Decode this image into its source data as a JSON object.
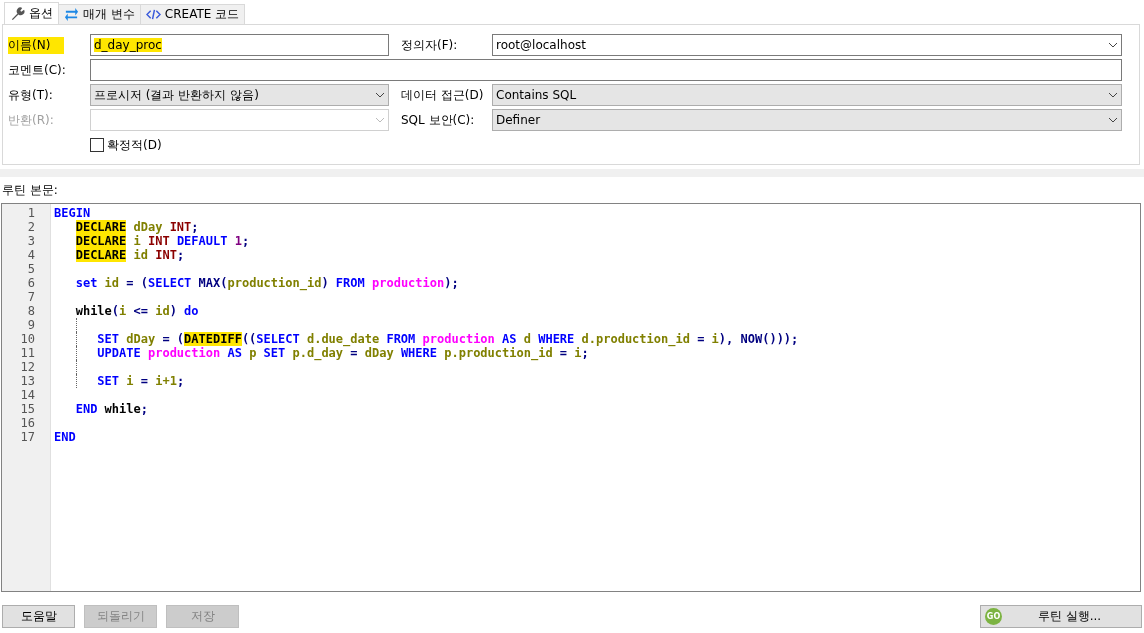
{
  "tabs": [
    {
      "label": "옵션",
      "selected": true
    },
    {
      "label": "매개 변수",
      "selected": false
    },
    {
      "label": "CREATE 코드",
      "selected": false
    }
  ],
  "form": {
    "name": {
      "label": "이름(N)",
      "value": "d_day_proc",
      "highlighted": true
    },
    "definer": {
      "label": "정의자(F):",
      "value": "root@localhost"
    },
    "comment": {
      "label": "코멘트(C):"
    },
    "type": {
      "label": "유형(T):",
      "value": "프로시저 (결과 반환하지 않음)"
    },
    "data_access": {
      "label": "데이터 접근(D)",
      "value": "Contains SQL"
    },
    "returns": {
      "label": "반환(R):",
      "disabled": true
    },
    "security": {
      "label": "SQL 보안(C):",
      "value": "Definer"
    },
    "deterministic": {
      "label": "확정적(D)",
      "checked": false
    }
  },
  "body_label": "루틴 본문:",
  "code": [
    {
      "n": "1",
      "guide": false,
      "tokens": [
        {
          "t": "BEGIN",
          "color": "#0000ff",
          "highlighted": false
        }
      ]
    },
    {
      "n": "2",
      "guide": false,
      "tokens": [
        {
          "t": "   DECLARE",
          "highlighted": true
        },
        {
          "t": " dDay ",
          "color": "#808000",
          "highlighted": false
        },
        {
          "t": "INT",
          "color": "#8b0000",
          "highlighted": false
        },
        {
          "t": ";",
          "color": "#000080",
          "highlighted": false
        }
      ]
    },
    {
      "n": "3",
      "guide": false,
      "tokens": [
        {
          "t": "   DECLARE",
          "highlighted": true
        },
        {
          "t": " i ",
          "color": "#808000",
          "highlighted": false
        },
        {
          "t": "INT",
          "color": "#8b0000",
          "highlighted": false
        },
        {
          "t": " DEFAULT",
          "color": "#0000ff",
          "highlighted": false
        },
        {
          "t": " 1",
          "color": "#800080",
          "highlighted": false
        },
        {
          "t": ";",
          "color": "#000080",
          "highlighted": false
        }
      ]
    },
    {
      "n": "4",
      "guide": false,
      "tokens": [
        {
          "t": "   DECLARE",
          "highlighted": true
        },
        {
          "t": " id ",
          "color": "#808000",
          "highlighted": false
        },
        {
          "t": "INT",
          "color": "#8b0000",
          "highlighted": false
        },
        {
          "t": ";",
          "color": "#000080",
          "highlighted": false
        }
      ]
    },
    {
      "n": "5",
      "guide": false
    },
    {
      "n": "6",
      "guide": false,
      "tokens": [
        {
          "t": "   set",
          "color": "#0000ff",
          "highlighted": false
        },
        {
          "t": " id ",
          "color": "#808000",
          "highlighted": false
        },
        {
          "t": "= (",
          "color": "#000080",
          "highlighted": false
        },
        {
          "t": "SELECT",
          "color": "#0000ff",
          "highlighted": false
        },
        {
          "t": " MAX(",
          "color": "#000080",
          "highlighted": false
        },
        {
          "t": "production_id",
          "color": "#808000",
          "highlighted": false
        },
        {
          "t": ") ",
          "color": "#000080",
          "highlighted": false
        },
        {
          "t": "FROM",
          "color": "#0000ff",
          "highlighted": false
        },
        {
          "t": " production",
          "color": "#ff00ff",
          "highlighted": false
        },
        {
          "t": ");",
          "color": "#000080",
          "highlighted": false
        }
      ]
    },
    {
      "n": "7",
      "guide": false
    },
    {
      "n": "8",
      "guide": false,
      "tokens": [
        {
          "t": "   while",
          "color": "#000000",
          "highlighted": false
        },
        {
          "t": "(",
          "color": "#000080",
          "highlighted": false
        },
        {
          "t": "i ",
          "color": "#808000",
          "highlighted": false
        },
        {
          "t": "<= ",
          "color": "#000080",
          "highlighted": false
        },
        {
          "t": "id",
          "color": "#808000",
          "highlighted": false
        },
        {
          "t": ") ",
          "color": "#000080",
          "highlighted": false
        },
        {
          "t": "do",
          "color": "#0000ff",
          "highlighted": false
        }
      ]
    },
    {
      "n": "9",
      "guide": true
    },
    {
      "n": "10",
      "guide": true,
      "tokens": [
        {
          "t": "      SET",
          "color": "#0000ff",
          "highlighted": false
        },
        {
          "t": " dDay ",
          "color": "#808000",
          "highlighted": false
        },
        {
          "t": "= (",
          "color": "#000080",
          "highlighted": false
        },
        {
          "t": "DATEDIFF",
          "highlighted": true
        },
        {
          "t": "((",
          "color": "#000080",
          "highlighted": false
        },
        {
          "t": "SELECT",
          "color": "#0000ff",
          "highlighted": false
        },
        {
          "t": " d.due_date ",
          "color": "#808000",
          "highlighted": false
        },
        {
          "t": "FROM",
          "color": "#0000ff",
          "highlighted": false
        },
        {
          "t": " production",
          "color": "#ff00ff",
          "highlighted": false
        },
        {
          "t": " AS",
          "color": "#0000ff",
          "highlighted": false
        },
        {
          "t": " d ",
          "color": "#808000",
          "highlighted": false
        },
        {
          "t": "WHERE",
          "color": "#0000ff",
          "highlighted": false
        },
        {
          "t": " d.production_id ",
          "color": "#808000",
          "highlighted": false
        },
        {
          "t": "= ",
          "color": "#000080",
          "highlighted": false
        },
        {
          "t": "i",
          "color": "#808000",
          "highlighted": false
        },
        {
          "t": "), NOW()));",
          "color": "#000080",
          "highlighted": false
        }
      ]
    },
    {
      "n": "11",
      "guide": true,
      "tokens": [
        {
          "t": "      UPDATE",
          "color": "#0000ff",
          "highlighted": false
        },
        {
          "t": " production",
          "color": "#ff00ff",
          "highlighted": false
        },
        {
          "t": " AS",
          "color": "#0000ff",
          "highlighted": false
        },
        {
          "t": " p ",
          "color": "#808000",
          "highlighted": false
        },
        {
          "t": "SET",
          "color": "#0000ff",
          "highlighted": false
        },
        {
          "t": " p.d_day ",
          "color": "#808000",
          "highlighted": false
        },
        {
          "t": "= ",
          "color": "#000080",
          "highlighted": false
        },
        {
          "t": "dDay ",
          "color": "#808000",
          "highlighted": false
        },
        {
          "t": "WHERE",
          "color": "#0000ff",
          "highlighted": false
        },
        {
          "t": " p.production_id ",
          "color": "#808000",
          "highlighted": false
        },
        {
          "t": "= ",
          "color": "#000080",
          "highlighted": false
        },
        {
          "t": "i",
          "color": "#808000",
          "highlighted": false
        },
        {
          "t": ";",
          "color": "#000080",
          "highlighted": false
        }
      ]
    },
    {
      "n": "12",
      "guide": true
    },
    {
      "n": "13",
      "guide": true,
      "tokens": [
        {
          "t": "      SET",
          "color": "#0000ff",
          "highlighted": false
        },
        {
          "t": " i ",
          "color": "#808000",
          "highlighted": false
        },
        {
          "t": "= ",
          "color": "#000080",
          "highlighted": false
        },
        {
          "t": "i+1",
          "color": "#808000",
          "highlighted": false
        },
        {
          "t": ";",
          "color": "#000080",
          "highlighted": false
        }
      ]
    },
    {
      "n": "14",
      "guide": false
    },
    {
      "n": "15",
      "guide": false,
      "tokens": [
        {
          "t": "   END",
          "color": "#0000ff",
          "highlighted": false
        },
        {
          "t": " while",
          "color": "#000000",
          "highlighted": false
        },
        {
          "t": ";",
          "color": "#000080",
          "highlighted": false
        }
      ]
    },
    {
      "n": "16",
      "guide": false
    },
    {
      "n": "17",
      "guide": false,
      "tokens": [
        {
          "t": "END",
          "color": "#0000ff",
          "highlighted": false
        }
      ]
    }
  ],
  "buttons": [
    {
      "label": "도움말",
      "disabled": false
    },
    {
      "label": "되돌리기",
      "disabled": true
    },
    {
      "label": "저장",
      "disabled": true
    }
  ],
  "run_button": {
    "label": "루틴 실행...",
    "badge": "GO"
  }
}
